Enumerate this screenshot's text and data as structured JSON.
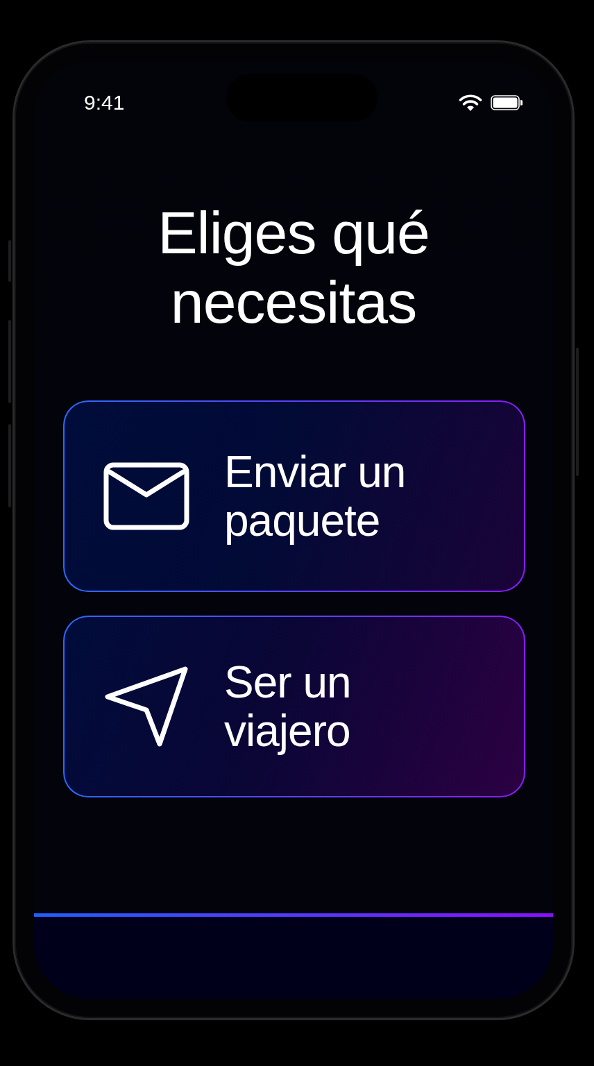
{
  "status_bar": {
    "time": "9:41"
  },
  "title": "Eliges qué necesitas",
  "options": [
    {
      "kind": "envelope",
      "label": "Enviar un paquete"
    },
    {
      "kind": "send",
      "label": "Ser un viajero"
    }
  ]
}
